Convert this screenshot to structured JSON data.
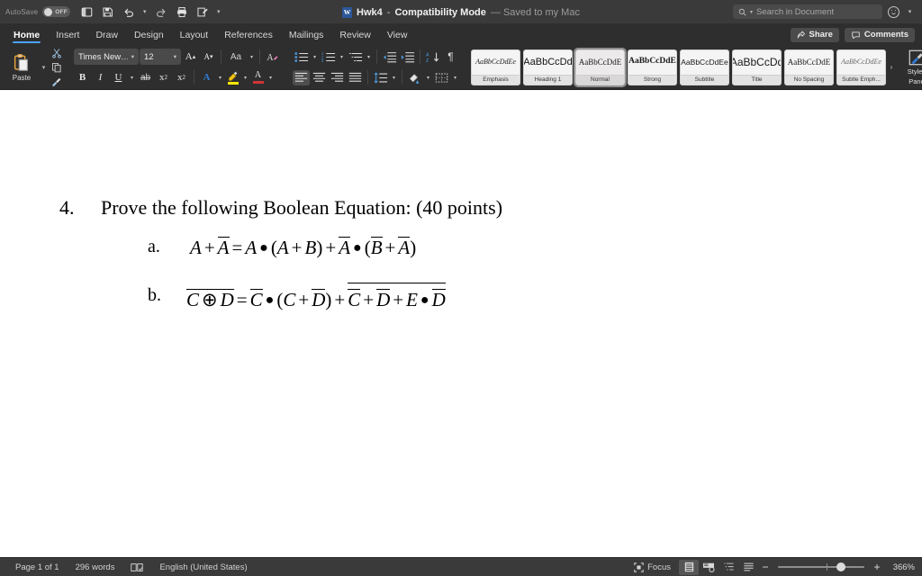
{
  "titlebar": {
    "autosave_label": "AutoSave",
    "autosave_state": "OFF",
    "quick_access": [
      "save-as-icon",
      "save-icon",
      "undo-icon",
      "undo-dropdown",
      "redo-icon",
      "print-icon",
      "review-icon",
      "customize-qat-icon"
    ],
    "doc_name": "Hwk4",
    "separator": "-",
    "mode": "Compatibility Mode",
    "saved_state": "— Saved to my Mac",
    "word_logo": "W",
    "search_placeholder": "Search in Document"
  },
  "tabs": [
    {
      "label": "Home",
      "active": true
    },
    {
      "label": "Insert",
      "active": false
    },
    {
      "label": "Draw",
      "active": false
    },
    {
      "label": "Design",
      "active": false
    },
    {
      "label": "Layout",
      "active": false
    },
    {
      "label": "References",
      "active": false
    },
    {
      "label": "Mailings",
      "active": false
    },
    {
      "label": "Review",
      "active": false
    },
    {
      "label": "View",
      "active": false
    }
  ],
  "tab_actions": {
    "share_label": "Share",
    "comments_label": "Comments"
  },
  "ribbon": {
    "clipboard": {
      "paste_label": "Paste",
      "cut_icon": "scissors-icon",
      "copy_icon": "copy-icon",
      "format_painter_icon": "format-painter-icon"
    },
    "font": {
      "font_name": "Times New…",
      "font_size": "12",
      "grow_font": "A",
      "shrink_font": "A",
      "change_case": "Aa",
      "clear_formatting": "A",
      "bold": "B",
      "italic": "I",
      "underline": "U",
      "strikethrough": "ab",
      "subscript": "x",
      "superscript": "x",
      "text_effects": "A",
      "highlight": "A",
      "font_color": "A",
      "font_color_hex": "#d13438",
      "highlight_hex": "#ffe600",
      "text_effects_hex": "#2f7bd6"
    },
    "paragraph": {
      "bullets": "bullets-icon",
      "numbering": "numbering-icon",
      "multilevel": "multilevel-list-icon",
      "decrease_indent": "decrease-indent-icon",
      "increase_indent": "increase-indent-icon",
      "sort": "sort-icon",
      "show_marks": "¶",
      "align_left": "align-left-icon",
      "align_center": "align-center-icon",
      "align_right": "align-right-icon",
      "justify": "justify-icon",
      "line_spacing": "line-spacing-icon",
      "shading": "shading-icon",
      "borders": "borders-icon"
    },
    "styles": [
      {
        "preview": "AaBbCcDdEe",
        "name": "Emphasis",
        "selected": false
      },
      {
        "preview": "AaBbCcDd",
        "name": "Heading 1",
        "selected": false
      },
      {
        "preview": "AaBbCcDdE",
        "name": "Normal",
        "selected": true
      },
      {
        "preview": "AaBbCcDdE",
        "name": "Strong",
        "selected": false
      },
      {
        "preview": "AaBbCcDdEe",
        "name": "Subtitle",
        "selected": false
      },
      {
        "preview": "AaBbCcDd",
        "name": "Title",
        "selected": false
      },
      {
        "preview": "AaBbCcDdE",
        "name": "No Spacing",
        "selected": false
      },
      {
        "preview": "AaBbCcDdEe",
        "name": "Subtle Emph...",
        "selected": false
      }
    ],
    "gallery_more": "›",
    "styles_pane": {
      "line1": "Styles",
      "line2": "Pane"
    }
  },
  "document": {
    "question_number": "4.",
    "question_text": "Prove the following Boolean Equation: (40 points)",
    "items": [
      {
        "label": "a.",
        "equation_plain": "A + A̅ = A • (A + B) + A̅ • (B̅ + A̅)"
      },
      {
        "label": "b.",
        "equation_plain": "C ⊕ D (bar) = C̅ • (C + D̅) + (C̅ + D̅ + E • D̅) (bar)"
      }
    ],
    "symbols": {
      "A": "A",
      "B": "B",
      "C": "C",
      "D": "D",
      "E": "E",
      "plus": "+",
      "equals": "=",
      "dot": "●",
      "xor": "⊕",
      "lparen": "(",
      "rparen": ")"
    }
  },
  "statusbar": {
    "page": "Page 1 of 1",
    "words": "296 words",
    "proofing_icon": "proofing-icon",
    "language": "English (United States)",
    "focus_label": "Focus",
    "view_print": "print-layout-icon",
    "view_web": "web-layout-icon",
    "view_outline": "outline-icon",
    "view_draft": "draft-icon",
    "zoom_out": "−",
    "zoom_in": "+",
    "zoom_level": "366%"
  }
}
